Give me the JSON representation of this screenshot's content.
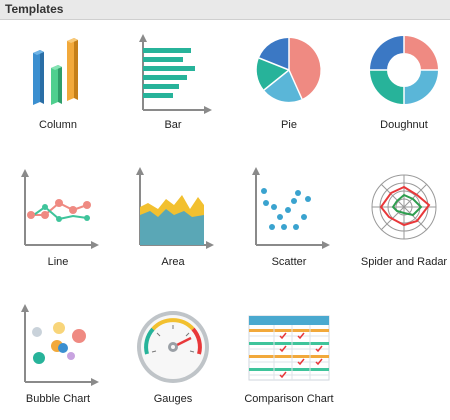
{
  "header": {
    "title": "Templates"
  },
  "templates": [
    {
      "label": "Column",
      "icon": "column-chart-icon"
    },
    {
      "label": "Bar",
      "icon": "bar-chart-icon"
    },
    {
      "label": "Pie",
      "icon": "pie-chart-icon"
    },
    {
      "label": "Doughnut",
      "icon": "doughnut-chart-icon"
    },
    {
      "label": "Line",
      "icon": "line-chart-icon"
    },
    {
      "label": "Area",
      "icon": "area-chart-icon"
    },
    {
      "label": "Scatter",
      "icon": "scatter-chart-icon"
    },
    {
      "label": "Spider and Radar",
      "icon": "radar-chart-icon"
    },
    {
      "label": "Bubble Chart",
      "icon": "bubble-chart-icon"
    },
    {
      "label": "Gauges",
      "icon": "gauge-icon"
    },
    {
      "label": "Comparison Chart",
      "icon": "comparison-chart-icon"
    }
  ],
  "colors": {
    "header_bg": "#e9e9e9",
    "axis": "#8a8a8a",
    "blue": "#3b8fd0",
    "green": "#3fc49b",
    "orange": "#f2a93b",
    "teal": "#27b39a",
    "salmon": "#ef8a82",
    "red": "#e8383a"
  }
}
